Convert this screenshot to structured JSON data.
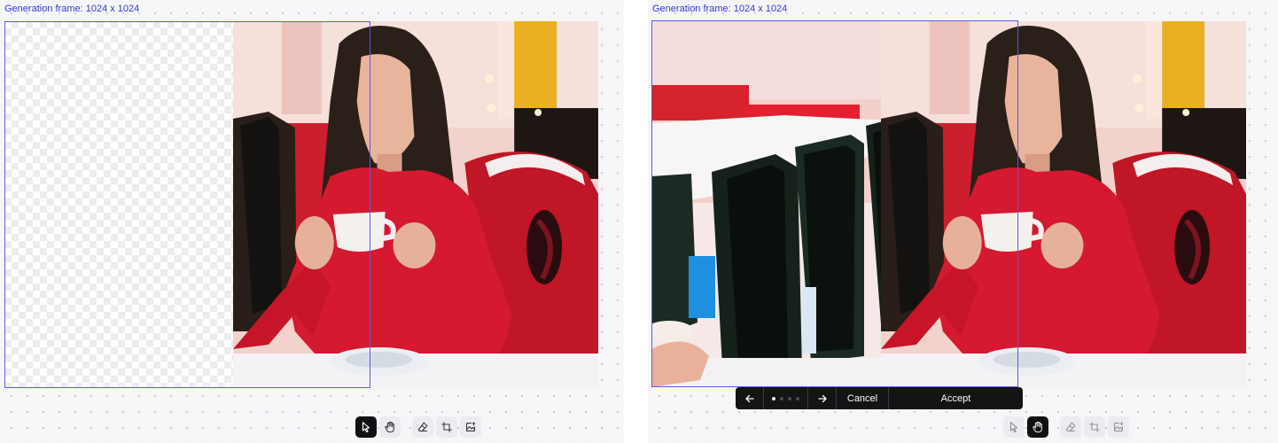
{
  "left_panel": {
    "frame_label": "Generation frame: 1024 x 1024",
    "toolbar": {
      "tools": [
        {
          "name": "select",
          "icon": "pointer-icon",
          "active": true
        },
        {
          "name": "pan",
          "icon": "hand-icon",
          "active": false
        },
        {
          "name": "erase",
          "icon": "eraser-icon",
          "active": false
        },
        {
          "name": "crop",
          "icon": "crop-icon",
          "active": false
        },
        {
          "name": "add-image",
          "icon": "image-add-icon",
          "active": false
        }
      ]
    }
  },
  "right_panel": {
    "frame_label": "Generation frame: 1024 x 1024",
    "variation_bar": {
      "prev_icon": "arrow-left-icon",
      "next_icon": "arrow-right-icon",
      "variation_count": 4,
      "current_variation": 1,
      "cancel_label": "Cancel",
      "accept_label": "Accept"
    },
    "toolbar": {
      "tools": [
        {
          "name": "select",
          "icon": "pointer-icon",
          "active": false
        },
        {
          "name": "pan",
          "icon": "hand-icon",
          "active": true
        },
        {
          "name": "erase",
          "icon": "eraser-icon",
          "active": false
        },
        {
          "name": "crop",
          "icon": "crop-icon",
          "active": false
        },
        {
          "name": "add-image",
          "icon": "image-add-icon",
          "active": false
        }
      ]
    }
  },
  "colors": {
    "frame_border": "#5a5ae8",
    "frame_label": "#3737d6",
    "toolbar_active": "#111114",
    "action_bar_bg": "#141416"
  }
}
